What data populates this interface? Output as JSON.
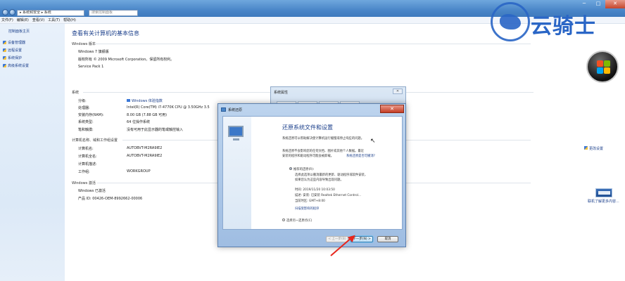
{
  "titlebar": {
    "address": "▸ 系统和安全 ▸ 系统",
    "search_placeholder": "搜索控制面板",
    "minimize": "─",
    "maximize": "□",
    "close": "✕"
  },
  "menu": [
    "文件(F)",
    "编辑(E)",
    "查看(V)",
    "工具(T)",
    "帮助(H)"
  ],
  "sidebar": {
    "home": "控制面板主页",
    "items": [
      {
        "label": "设备管理器",
        "icon": "shield-icon"
      },
      {
        "label": "远程设置",
        "icon": "shield-icon"
      },
      {
        "label": "系统保护",
        "icon": "shield-icon"
      },
      {
        "label": "高级系统设置",
        "icon": "shield-icon"
      }
    ]
  },
  "main": {
    "title": "查看有关计算机的基本信息",
    "edition_header": "Windows 版本",
    "edition": "Windows 7 旗舰版",
    "copyright": "版权所有 © 2009 Microsoft Corporation。保留所有权利。",
    "service_pack": "Service Pack 1",
    "system_header": "系统",
    "rating_label": "分级:",
    "rating_value": "Windows 体验指数",
    "processor_label": "处理器:",
    "processor_value": "Intel(R) Core(TM) i7-4770K CPU @ 3.50GHz   3.5",
    "ram_label": "安装内存(RAM):",
    "ram_value": "8.00 GB (7.88 GB 可用)",
    "systype_label": "系统类型:",
    "systype_value": "64 位操作系统",
    "pen_label": "笔和触摸:",
    "pen_value": "没有可用于此显示器的笔或触控输入",
    "name_header": "计算机名称、域和工作组设置",
    "cname_label": "计算机名:",
    "cname_value": "AUTOBVT-M2RA9IE2",
    "cfull_label": "计算机全名:",
    "cfull_value": "AUTOBVT-M2RA9IE2",
    "cdesc_label": "计算机描述:",
    "wg_label": "工作组:",
    "wg_value": "WORKGROUP",
    "change_settings": "更改设置",
    "activation_header": "Windows 激活",
    "activated": "Windows 已激活",
    "product_id": "产品 ID: 00426-OEM-8992662-00006",
    "more_info": "联机了解更多内容..."
  },
  "watermark": {
    "text": "云骑士"
  },
  "bg_dialog": {
    "title": "系统属性",
    "close": "✕"
  },
  "restore_dialog": {
    "title": "系统还原",
    "close": "✕",
    "heading": "还原系统文件和设置",
    "desc1": "系统还原可以帮助解决使计算机运行缓慢或停止响应的问题。",
    "desc2": "系统还原不会影响您的任何文档、图片或其他个人数据。最近",
    "desc3": "安装的程序和驱动程序可能会被卸载。",
    "link1": "系统还原是否可撤消?",
    "option1": "推荐的还原(R):",
    "opt1_desc1": "选择此选项以撤消最新的更新、驱动程序或软件安装，",
    "opt1_desc2": "如果您认为这些内容导致出现问题。",
    "time": "时间:  2019/11/20 10:03:50",
    "description": "描述:  安装: 已安装 Realtek Ethernet Control...",
    "timezone": "当前时区:  GMT+8:00",
    "link2": "扫描受影响的程序",
    "option2": "选择另一还原点(C)",
    "back": "< 上一步(B)",
    "next": "下一步(N) >",
    "cancel": "取消"
  }
}
